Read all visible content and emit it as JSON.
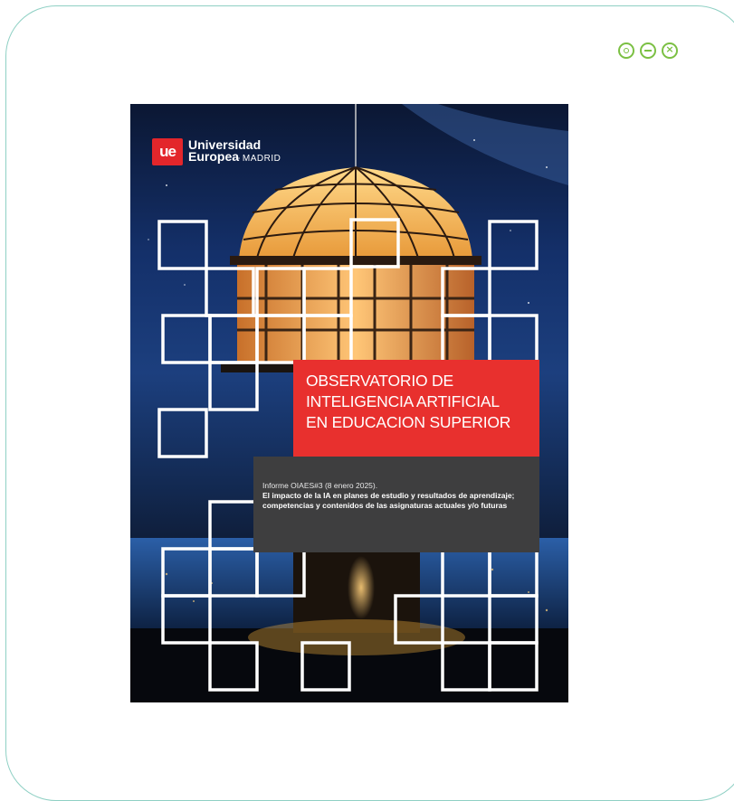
{
  "window": {
    "controls": [
      {
        "name": "settings-button",
        "icon": "circle-dot-icon"
      },
      {
        "name": "minimize-button",
        "icon": "minus-circle-icon"
      },
      {
        "name": "close-button",
        "icon": "close-circle-icon",
        "glyph": "×"
      }
    ],
    "accent_color": "#7bc043",
    "border_color": "#8fd0c4"
  },
  "cover": {
    "logo": {
      "mark": "ue",
      "line1": "Universidad",
      "line2_bold": "Europea",
      "line2_light": "MADRID"
    },
    "title_lines": [
      "OBSERVATORIO DE",
      "INTELIGENCIA ARTIFICIAL",
      "EN EDUCACION SUPERIOR"
    ],
    "report_label": "Informe OIAES#3 (8 enero 2025).",
    "report_body": "El impacto de la IA en planes de estudio y resultados de aprendizaje; competencias y contenidos de las asignaturas actuales y/o futuras",
    "title_color": "#e8302e",
    "info_color": "#3e3e3f"
  }
}
